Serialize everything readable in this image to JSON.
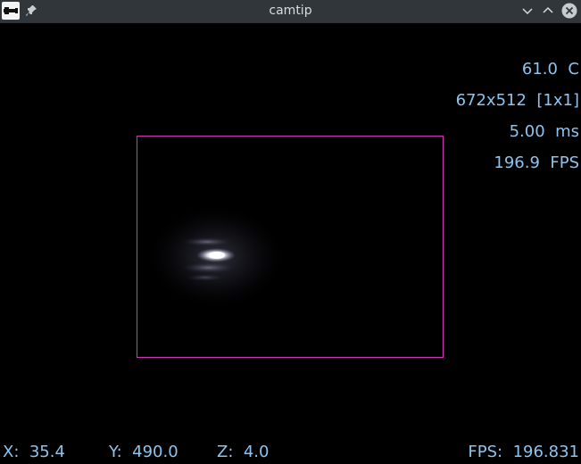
{
  "window": {
    "title": "camtip"
  },
  "icons": {
    "app": "camtip-logo-icon",
    "pin": "pin-icon",
    "minimize": "chevron-down-icon",
    "maximize": "chevron-up-icon",
    "close": "close-icon"
  },
  "overlay": {
    "temperature": "61.0  C",
    "resolution": "672x512  [1x1]",
    "exposure": "5.00  ms",
    "fps": "196.9  FPS"
  },
  "status": {
    "x": "X:  35.4",
    "y": "Y:  490.0",
    "z": "Z:  4.0",
    "fps": "FPS:  196.831"
  },
  "colors": {
    "background": "#000000",
    "titlebar": "#31363b",
    "text": "#8cc4ee",
    "roi_border": "#d136b8"
  }
}
